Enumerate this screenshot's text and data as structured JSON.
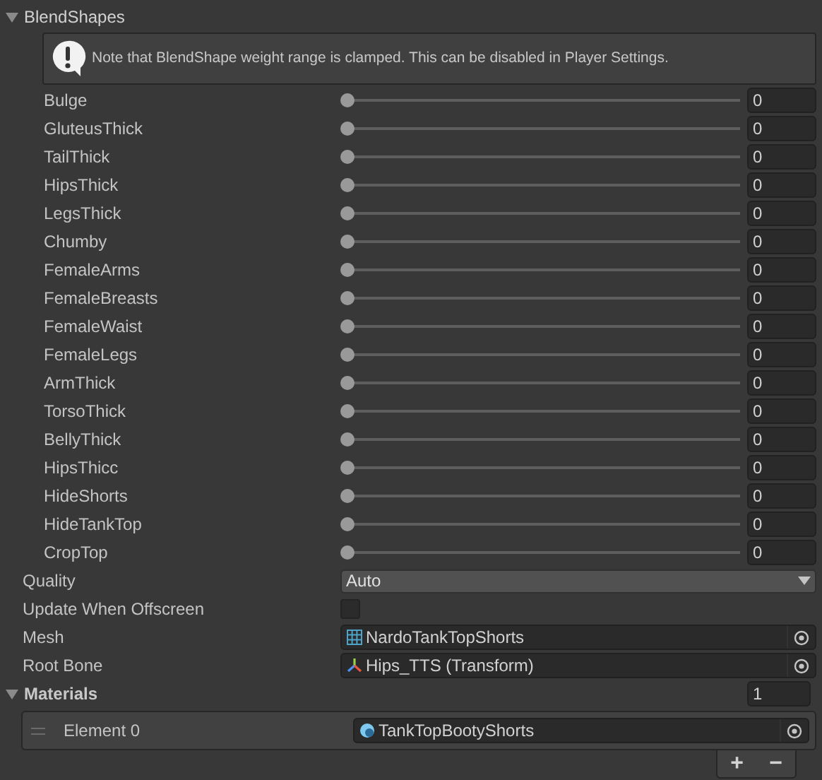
{
  "blend_shapes": {
    "title": "BlendShapes",
    "expanded": true,
    "notice": "Note that BlendShape weight range is clamped. This can be disabled in Player Settings.",
    "items": [
      {
        "name": "Bulge",
        "level": 0,
        "value": "0"
      },
      {
        "name": "GluteusThick",
        "level": 0,
        "value": "0"
      },
      {
        "name": "TailThick",
        "level": 0,
        "value": "0"
      },
      {
        "name": "HipsThick",
        "level": 0,
        "value": "0"
      },
      {
        "name": "LegsThick",
        "level": 0,
        "value": "0"
      },
      {
        "name": "Chumby",
        "level": 0,
        "value": "0"
      },
      {
        "name": "FemaleArms",
        "level": 0,
        "value": "0"
      },
      {
        "name": "FemaleBreasts",
        "level": 0,
        "value": "0"
      },
      {
        "name": "FemaleWaist",
        "level": 0,
        "value": "0"
      },
      {
        "name": "FemaleLegs",
        "level": 0,
        "value": "0"
      },
      {
        "name": "ArmThick",
        "level": 0,
        "value": "0"
      },
      {
        "name": "TorsoThick",
        "level": 0,
        "value": "0"
      },
      {
        "name": "BellyThick",
        "level": 0,
        "value": "0"
      },
      {
        "name": "HipsThicc",
        "level": 0,
        "value": "0"
      },
      {
        "name": "HideShorts",
        "level": 0,
        "value": "0"
      },
      {
        "name": "HideTankTop",
        "level": 0,
        "value": "0"
      },
      {
        "name": "CropTop",
        "level": 0,
        "value": "0"
      }
    ]
  },
  "properties": [
    {
      "kind": "dropdown",
      "label": "Quality",
      "value": "Auto"
    },
    {
      "kind": "checkbox",
      "label": "Update When Offscreen",
      "checked": false
    },
    {
      "kind": "object",
      "label": "Mesh",
      "value": "NardoTankTopShorts"
    },
    {
      "kind": "object",
      "label": "Root Bone",
      "value": "Hips_TTS (Transform)"
    }
  ],
  "materials": {
    "title": "Materials",
    "expanded": true,
    "size": "1",
    "elements": [
      {
        "label": "Element 0",
        "value": "TankTopBootyShorts"
      }
    ],
    "buttons": [
      "+",
      "−"
    ]
  }
}
